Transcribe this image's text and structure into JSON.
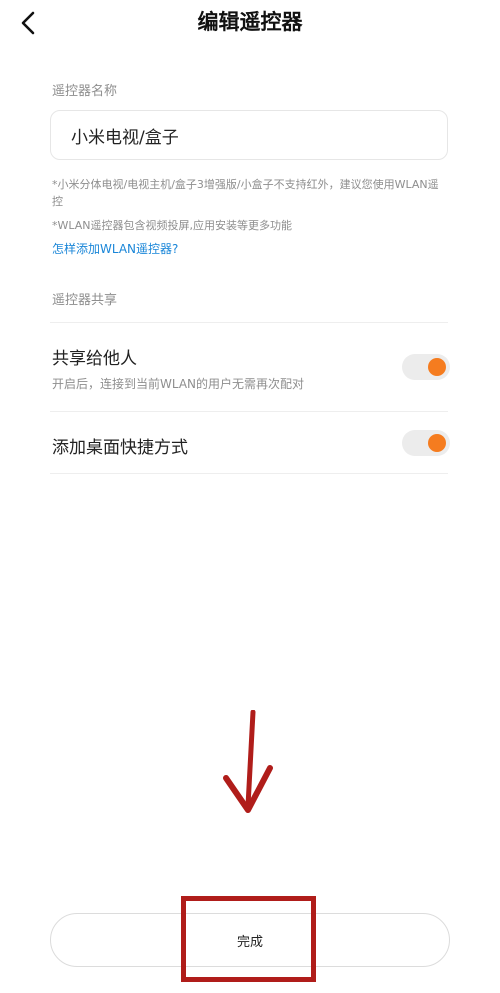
{
  "header": {
    "title": "编辑遥控器"
  },
  "name_section": {
    "label": "遥控器名称",
    "value": "小米电视/盒子",
    "note_1": "*小米分体电视/电视主机/盒子3增强版/小盒子不支持红外，建议您使用WLAN遥控",
    "note_2": "*WLAN遥控器包含视频投屏,应用安装等更多功能",
    "help_link": "怎样添加WLAN遥控器?"
  },
  "share_section": {
    "label": "遥控器共享",
    "items": [
      {
        "title": "共享给他人",
        "desc": "开启后，连接到当前WLAN的用户无需再次配对",
        "enabled": true
      },
      {
        "title": "添加桌面快捷方式",
        "enabled": true
      }
    ]
  },
  "footer": {
    "done_label": "完成"
  },
  "colors": {
    "accent": "#f57c1f",
    "link": "#1a86d8",
    "annotation": "#b01d1a"
  }
}
